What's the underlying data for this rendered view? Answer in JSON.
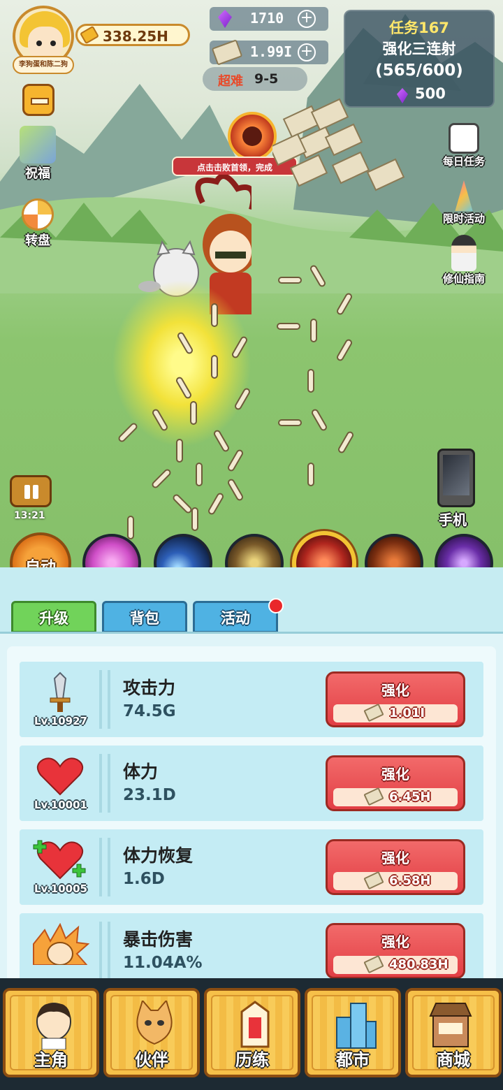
{
  "player": {
    "name": "李狗蛋和陈二狗",
    "gold": "338.25H"
  },
  "currency": {
    "gems": "1710",
    "cash": "1.99I"
  },
  "difficulty": {
    "label": "超难",
    "stage": "9-5"
  },
  "quest": {
    "title": "任务167",
    "name": "强化三连射",
    "progress": "(565/600)",
    "reward": "500"
  },
  "left_menu": {
    "blessing": "祝福",
    "wheel": "转盘"
  },
  "right_menu": {
    "daily": "每日任务",
    "limited": "限时活动",
    "guide": "修仙指南"
  },
  "boss_banner": "点击击败首领，完成",
  "timer": "13:21",
  "phone_label": "手机",
  "auto_label": "自动",
  "skills": [
    {
      "name": "skill-pink-vortex",
      "color": "#d04fc8"
    },
    {
      "name": "skill-blue-comet",
      "color": "#2d5fb8"
    },
    {
      "name": "skill-lightning-pillar",
      "color": "#7a5a2a"
    },
    {
      "name": "skill-red-wave",
      "color": "#b0261e"
    },
    {
      "name": "skill-dark-warrior",
      "color": "#7a2e10"
    },
    {
      "name": "skill-purple-burst",
      "color": "#6a2ea8"
    }
  ],
  "tabs": {
    "upgrade": "升级",
    "bag": "背包",
    "event": "活动"
  },
  "stats": [
    {
      "name": "攻击力",
      "value": "74.5G",
      "level": "Lv.10927",
      "button": "强化",
      "cost": "1.01I",
      "icon": "sword-icon"
    },
    {
      "name": "体力",
      "value": "23.1D",
      "level": "Lv.10001",
      "button": "强化",
      "cost": "6.45H",
      "icon": "heart-icon"
    },
    {
      "name": "体力恢复",
      "value": "1.6D",
      "level": "Lv.10005",
      "button": "强化",
      "cost": "6.58H",
      "icon": "heart-plus-icon"
    },
    {
      "name": "暴击伤害",
      "value": "11.04A%",
      "level": "",
      "button": "强化",
      "cost": "480.83H",
      "icon": "fist-icon"
    }
  ],
  "nav": {
    "hero": "主角",
    "partner": "伙伴",
    "training": "历练",
    "city": "都市",
    "shop": "商城"
  },
  "colors": {
    "accent_gold": "#f6c049",
    "upgrade_red": "#e23e44",
    "tab_green": "#71d35a",
    "tab_blue": "#4fb2e3"
  }
}
